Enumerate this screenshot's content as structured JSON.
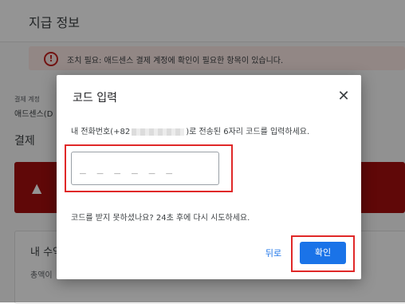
{
  "header": {
    "title": "지급 정보"
  },
  "warning": {
    "icon": "alert-circle-icon",
    "text": "조치 필요: 애드센스 결제 계정에 확인이 필요한 항목이 있습니다."
  },
  "account": {
    "label": "결제 계정",
    "value": "애드센스(D"
  },
  "payments": {
    "title": "결제"
  },
  "revenue": {
    "title": "내 수익",
    "subtitle": "총액이"
  },
  "dialog": {
    "title": "코드 입력",
    "close_icon": "close-icon",
    "instruction_prefix": "내 전화번호(+82",
    "instruction_suffix": ")로 전송된 6자리 코드를 입력하세요.",
    "code_placeholder": "_ _ _ _ _ _",
    "hint": "코드를 받지 못하셨나요? 24초 후에 다시 시도하세요.",
    "back_label": "뒤로",
    "confirm_label": "확인"
  },
  "colors": {
    "accent": "#1a73e8",
    "highlight": "#e02828",
    "alert": "#a50e0e"
  }
}
